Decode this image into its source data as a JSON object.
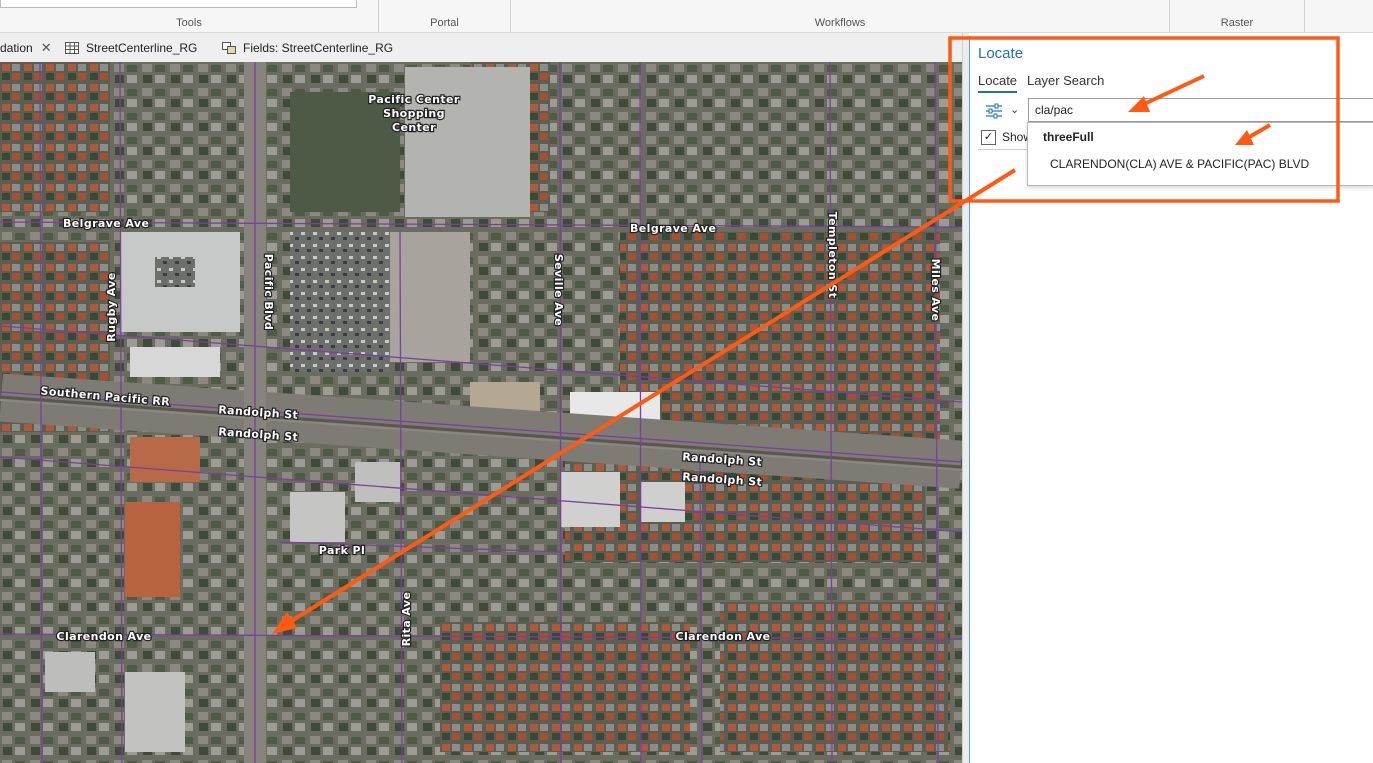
{
  "ribbon": {
    "groups": [
      {
        "label": "Tools"
      },
      {
        "label": "Portal"
      },
      {
        "label": "Workflows"
      },
      {
        "label": "Raster"
      }
    ]
  },
  "tabs": [
    {
      "label": "dation",
      "icon": "close-icon"
    },
    {
      "label": "StreetCenterline_RG",
      "icon": "table-icon"
    },
    {
      "label": "Fields: StreetCenterline_RG",
      "icon": "fields-icon"
    }
  ],
  "map": {
    "poi": [
      "Pacific Center",
      "Shopping",
      "Center"
    ],
    "streets": {
      "belgrave_w": "Belgrave Ave",
      "belgrave_e": "Belgrave Ave",
      "rugby": "Rugby Ave",
      "pacific": "Pacific Blvd",
      "seville": "Seville Ave",
      "templeton": "Templeton St",
      "miles": "Miles Ave",
      "southern_pacific": "Southern Pacific RR",
      "randolph_w1": "Randolph St",
      "randolph_w2": "Randolph St",
      "randolph_e1": "Randolph St",
      "randolph_e2": "Randolph St",
      "park": "Park Pl",
      "rita": "Rita Ave",
      "clarendon_w": "Clarendon Ave",
      "clarendon_e": "Clarendon Ave"
    }
  },
  "locate_pane": {
    "title": "Locate",
    "tabs": [
      "Locate",
      "Layer Search"
    ],
    "search_value": "cla/pac",
    "show_label": "Show",
    "show_checked": "✓",
    "suggestion_group": "threeFull",
    "suggestion_item": "CLARENDON(CLA) AVE & PACIFIC(PAC) BLVD"
  },
  "colors": {
    "accent": "#1f6fbf",
    "annotation": "#ff5a14",
    "street_line": "#7a3fa0"
  }
}
